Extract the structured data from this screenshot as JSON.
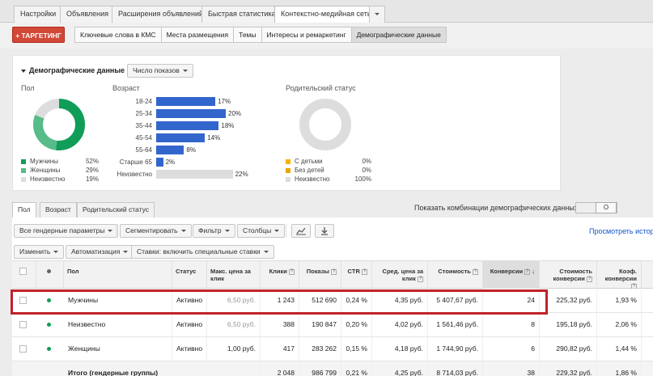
{
  "top_tabs": [
    "Настройки",
    "Объявления",
    "Расширения объявлений",
    "Быстрая статистика",
    "Контекстно-медийная сеть"
  ],
  "targeting_button": "+ ТАРГЕТИНГ",
  "sub_tabs": [
    "Ключевые слова в КМС",
    "Места размещения",
    "Темы",
    "Интересы и ремаркетинг",
    "Демографические данные"
  ],
  "panel": {
    "title": "Демографические данные",
    "metric_dropdown": "Число показов",
    "gender": {
      "title": "Пол",
      "items": [
        {
          "label": "Мужчины",
          "value": "52%",
          "pct": 52,
          "color": "#0f9d58"
        },
        {
          "label": "Женщины",
          "value": "29%",
          "pct": 29,
          "color": "#57bb8a"
        },
        {
          "label": "Неизвестно",
          "value": "19%",
          "pct": 19,
          "color": "#dddddd"
        }
      ]
    },
    "age": {
      "title": "Возраст",
      "items": [
        {
          "label": "18-24",
          "value": "17%",
          "pct": 17,
          "color": "#3366cc"
        },
        {
          "label": "25-34",
          "value": "20%",
          "pct": 20,
          "color": "#3366cc"
        },
        {
          "label": "35-44",
          "value": "18%",
          "pct": 18,
          "color": "#3366cc"
        },
        {
          "label": "45-54",
          "value": "14%",
          "pct": 14,
          "color": "#3366cc"
        },
        {
          "label": "55-64",
          "value": "8%",
          "pct": 8,
          "color": "#3366cc"
        },
        {
          "label": "Старше 65",
          "value": "2%",
          "pct": 2,
          "color": "#3366cc"
        },
        {
          "label": "Неизвестно",
          "value": "22%",
          "pct": 22,
          "color": "#dddddd"
        }
      ]
    },
    "parental": {
      "title": "Родительский статус",
      "items": [
        {
          "label": "С детьми",
          "value": "0%",
          "pct": 0,
          "color": "#f4b400"
        },
        {
          "label": "Без детей",
          "value": "0%",
          "pct": 0,
          "color": "#e9a700"
        },
        {
          "label": "Неизвестно",
          "value": "100%",
          "pct": 100,
          "color": "#dddddd"
        }
      ]
    }
  },
  "table_tabs": [
    "Пол",
    "Возраст",
    "Родительский статус"
  ],
  "combo_label": "Показать комбинации демографических данных:",
  "toggle_label": "O",
  "toolbar": {
    "gender_params": "Все гендерные параметры",
    "segment": "Сегментировать",
    "filter": "Фильтр",
    "columns": "Столбцы",
    "edit": "Изменить",
    "automation": "Автоматизация",
    "bids": "Ставки: включить специальные ставки",
    "history_link": "Просмотреть истор"
  },
  "table": {
    "headers": [
      "Пол",
      "Статус",
      "Макс. цена за клик",
      "Клики",
      "Показы",
      "CTR",
      "Сред. цена за клик",
      "Стоимость",
      "Конверсии",
      "Стоимость конверсии",
      "Коэф. конверсии"
    ],
    "rows": [
      {
        "gender": "Мужчины",
        "status": "Активно",
        "max_cpc": "6,50 руб.",
        "clicks": "1 243",
        "impressions": "512 690",
        "ctr": "0,24 %",
        "avg_cpc": "4,35 руб.",
        "cost": "5 407,67 руб.",
        "conversions": "24",
        "cost_conv": "225,32 руб.",
        "conv_rate": "1,93 %"
      },
      {
        "gender": "Неизвестно",
        "status": "Активно",
        "max_cpc": "6,50 руб.",
        "clicks": "388",
        "impressions": "190 847",
        "ctr": "0,20 %",
        "avg_cpc": "4,02 руб.",
        "cost": "1 561,46 руб.",
        "conversions": "8",
        "cost_conv": "195,18 руб.",
        "conv_rate": "2,06 %"
      },
      {
        "gender": "Женщины",
        "status": "Активно",
        "max_cpc": "1,00 руб.",
        "clicks": "417",
        "impressions": "283 262",
        "ctr": "0,15 %",
        "avg_cpc": "4,18 руб.",
        "cost": "1 744,90 руб.",
        "conversions": "6",
        "cost_conv": "290,82 руб.",
        "conv_rate": "1,44 %"
      }
    ],
    "total": {
      "label": "Итого (гендерные группы)",
      "clicks": "2 048",
      "impressions": "986 799",
      "ctr": "0,21 %",
      "avg_cpc": "4,25 руб.",
      "cost": "8 714,03 руб.",
      "conversions": "38",
      "cost_conv": "229,32 руб.",
      "conv_rate": "1,86 %"
    }
  }
}
